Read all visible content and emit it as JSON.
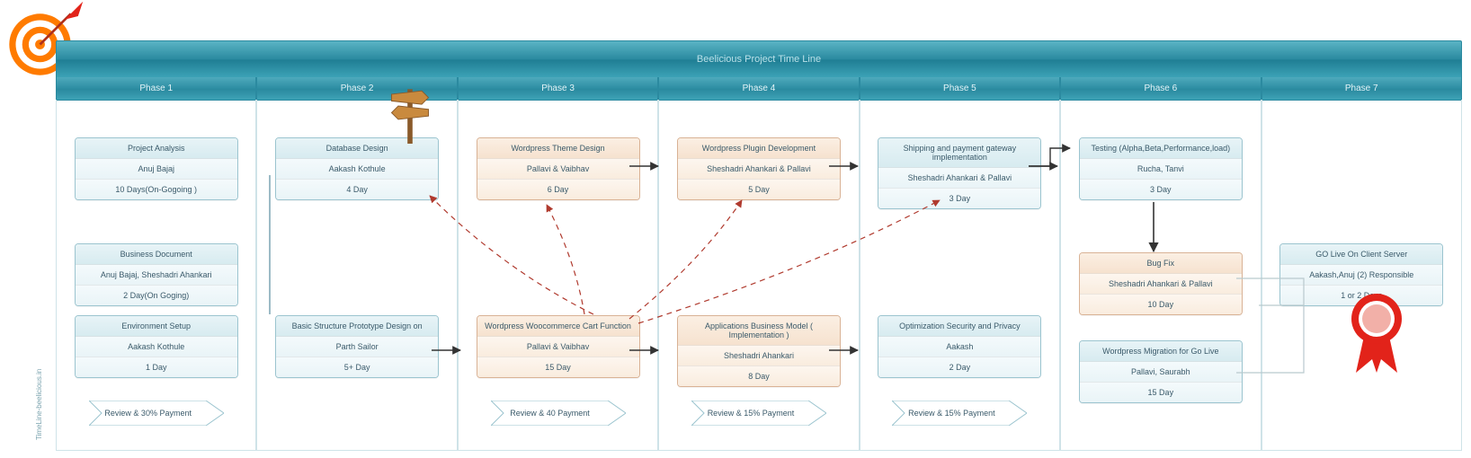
{
  "title": "Beelicious Project Time Line",
  "side_label": "TimeLine-beelicious.in",
  "phases": [
    "Phase 1",
    "Phase 2",
    "Phase 3",
    "Phase 4",
    "Phase 5",
    "Phase 6",
    "Phase 7"
  ],
  "cards": {
    "p1a": {
      "title": "Project Analysis",
      "who": "Anuj Bajaj",
      "dur": "10 Days(On-Gogoing )"
    },
    "p1b": {
      "title": "Business Document",
      "who": "Anuj Bajaj, Sheshadri Ahankari",
      "dur": "2 Day(On Goging)"
    },
    "p1c": {
      "title": "Environment Setup",
      "who": "Aakash Kothule",
      "dur": "1 Day"
    },
    "p2a": {
      "title": "Database Design",
      "who": "Aakash Kothule",
      "dur": "4 Day"
    },
    "p2b": {
      "title": "Basic Structure Prototype Design on",
      "who": "Parth Sailor",
      "dur": "5+ Day"
    },
    "p3a": {
      "title": "Wordpress Theme Design",
      "who": "Pallavi & Vaibhav",
      "dur": "6 Day"
    },
    "p3b": {
      "title": "Wordpress Woocommerce Cart Function",
      "who": "Pallavi & Vaibhav",
      "dur": "15 Day"
    },
    "p4a": {
      "title": "Wordpress Plugin Development",
      "who": "Sheshadri Ahankari & Pallavi",
      "dur": "5 Day"
    },
    "p4b": {
      "title": "Applications Business Model ( Implementation )",
      "who": "Sheshadri Ahankari",
      "dur": "8 Day"
    },
    "p5a": {
      "title": "Shipping and payment gateway implementation",
      "who": "Sheshadri Ahankari & Pallavi",
      "dur": "3 Day"
    },
    "p5b": {
      "title": "Optimization\nSecurity and Privacy",
      "who": "Aakash",
      "dur": "2 Day"
    },
    "p6a": {
      "title": "Testing\n(Alpha,Beta,Performance,load)",
      "who": "Rucha, Tanvi",
      "dur": "3 Day"
    },
    "p6b": {
      "title": "Bug Fix",
      "who": "Sheshadri Ahankari & Pallavi",
      "dur": "10 Day"
    },
    "p6c": {
      "title": "Wordpress Migration for Go Live",
      "who": "Pallavi, Saurabh",
      "dur": "15 Day"
    },
    "p7a": {
      "title": "GO Live On Client Server",
      "who": "Aakash,Anuj (2) Responsible",
      "dur": "1 or 2 Days"
    }
  },
  "payments": {
    "pay1": "Review & 30% Payment",
    "pay3": "Review & 40 Payment",
    "pay4": "Review & 15% Payment",
    "pay5": "Review & 15% Payment"
  }
}
